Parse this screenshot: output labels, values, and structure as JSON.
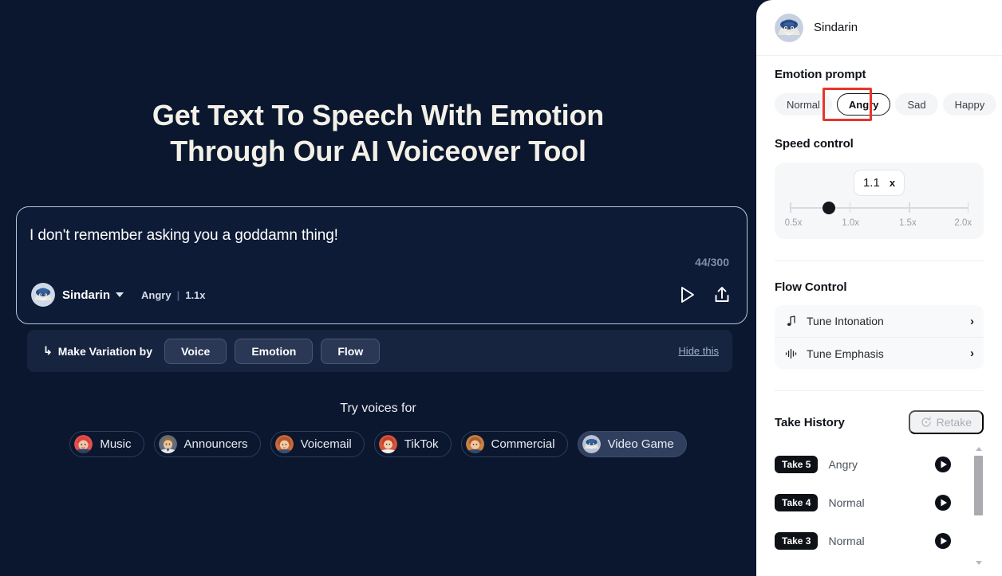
{
  "hero": {
    "line1": "Get Text To Speech With Emotion",
    "line2": "Through Our AI Voiceover Tool"
  },
  "prompt_card": {
    "text": "I don't remember asking you a goddamn thing!",
    "char_count": "44/300",
    "voice_name": "Sindarin",
    "emotion": "Angry",
    "separator": "|",
    "speed": "1.1x",
    "play_icon": "play-icon",
    "share_icon": "share-icon"
  },
  "variation": {
    "arrow": "↳",
    "label": "Make Variation by",
    "buttons": [
      "Voice",
      "Emotion",
      "Flow"
    ],
    "hide_link": "Hide this"
  },
  "try_voices": {
    "title": "Try voices for",
    "chips": [
      {
        "label": "Music",
        "selected": false
      },
      {
        "label": "Announcers",
        "selected": false
      },
      {
        "label": "Voicemail",
        "selected": false
      },
      {
        "label": "TikTok",
        "selected": false
      },
      {
        "label": "Commercial",
        "selected": false
      },
      {
        "label": "Video Game",
        "selected": true
      }
    ]
  },
  "panel": {
    "user": {
      "name": "Sindarin",
      "avatar_icon": "wizard-avatar"
    },
    "emotion": {
      "title": "Emotion prompt",
      "options": [
        "Normal",
        "Angry",
        "Sad",
        "Happy"
      ],
      "selected": "Angry",
      "highlight_color": "#e8342c"
    },
    "speed": {
      "title": "Speed control",
      "value": "1.1",
      "unit": "x",
      "thumb_percent": 22,
      "ticks": [
        "0.5x",
        "1.0x",
        "1.5x",
        "2.0x"
      ]
    },
    "flow": {
      "title": "Flow Control",
      "items": [
        {
          "label": "Tune Intonation",
          "icon": "music-note-icon",
          "chevron": "›"
        },
        {
          "label": "Tune Emphasis",
          "icon": "waveform-icon",
          "chevron": "›"
        }
      ]
    },
    "takes": {
      "title": "Take History",
      "retake_label": "Retake",
      "retake_icon": "refresh-icon",
      "rows": [
        {
          "badge": "Take 5",
          "emotion": "Angry"
        },
        {
          "badge": "Take 4",
          "emotion": "Normal"
        },
        {
          "badge": "Take 3",
          "emotion": "Normal"
        }
      ]
    }
  },
  "colors": {
    "background": "#0b172e",
    "panel": "#ffffff",
    "accent_red": "#e8342c",
    "card_border": "#b9c4d8"
  }
}
